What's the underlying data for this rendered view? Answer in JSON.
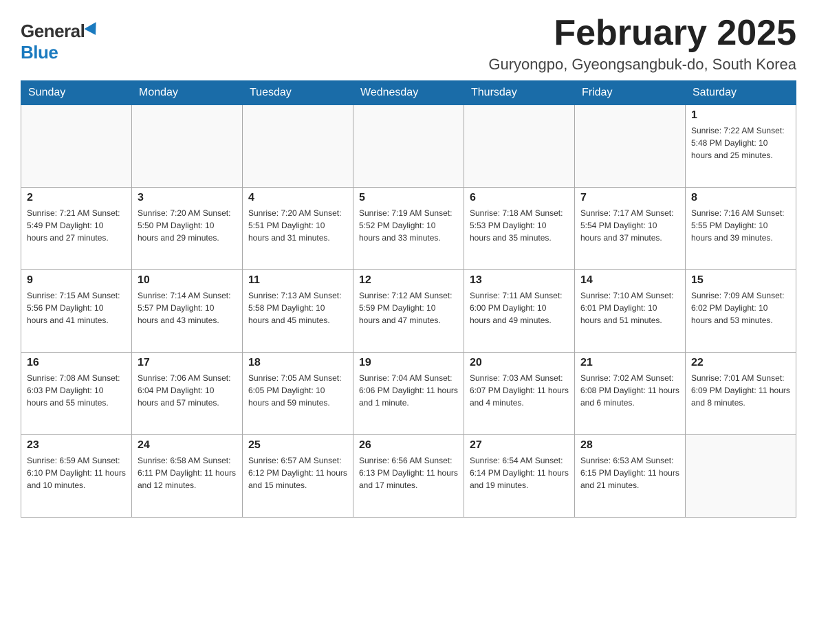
{
  "header": {
    "logo_general": "General",
    "logo_blue": "Blue",
    "month_title": "February 2025",
    "location": "Guryongpo, Gyeongsangbuk-do, South Korea"
  },
  "weekdays": [
    "Sunday",
    "Monday",
    "Tuesday",
    "Wednesday",
    "Thursday",
    "Friday",
    "Saturday"
  ],
  "weeks": [
    [
      {
        "day": "",
        "info": ""
      },
      {
        "day": "",
        "info": ""
      },
      {
        "day": "",
        "info": ""
      },
      {
        "day": "",
        "info": ""
      },
      {
        "day": "",
        "info": ""
      },
      {
        "day": "",
        "info": ""
      },
      {
        "day": "1",
        "info": "Sunrise: 7:22 AM\nSunset: 5:48 PM\nDaylight: 10 hours and 25 minutes."
      }
    ],
    [
      {
        "day": "2",
        "info": "Sunrise: 7:21 AM\nSunset: 5:49 PM\nDaylight: 10 hours and 27 minutes."
      },
      {
        "day": "3",
        "info": "Sunrise: 7:20 AM\nSunset: 5:50 PM\nDaylight: 10 hours and 29 minutes."
      },
      {
        "day": "4",
        "info": "Sunrise: 7:20 AM\nSunset: 5:51 PM\nDaylight: 10 hours and 31 minutes."
      },
      {
        "day": "5",
        "info": "Sunrise: 7:19 AM\nSunset: 5:52 PM\nDaylight: 10 hours and 33 minutes."
      },
      {
        "day": "6",
        "info": "Sunrise: 7:18 AM\nSunset: 5:53 PM\nDaylight: 10 hours and 35 minutes."
      },
      {
        "day": "7",
        "info": "Sunrise: 7:17 AM\nSunset: 5:54 PM\nDaylight: 10 hours and 37 minutes."
      },
      {
        "day": "8",
        "info": "Sunrise: 7:16 AM\nSunset: 5:55 PM\nDaylight: 10 hours and 39 minutes."
      }
    ],
    [
      {
        "day": "9",
        "info": "Sunrise: 7:15 AM\nSunset: 5:56 PM\nDaylight: 10 hours and 41 minutes."
      },
      {
        "day": "10",
        "info": "Sunrise: 7:14 AM\nSunset: 5:57 PM\nDaylight: 10 hours and 43 minutes."
      },
      {
        "day": "11",
        "info": "Sunrise: 7:13 AM\nSunset: 5:58 PM\nDaylight: 10 hours and 45 minutes."
      },
      {
        "day": "12",
        "info": "Sunrise: 7:12 AM\nSunset: 5:59 PM\nDaylight: 10 hours and 47 minutes."
      },
      {
        "day": "13",
        "info": "Sunrise: 7:11 AM\nSunset: 6:00 PM\nDaylight: 10 hours and 49 minutes."
      },
      {
        "day": "14",
        "info": "Sunrise: 7:10 AM\nSunset: 6:01 PM\nDaylight: 10 hours and 51 minutes."
      },
      {
        "day": "15",
        "info": "Sunrise: 7:09 AM\nSunset: 6:02 PM\nDaylight: 10 hours and 53 minutes."
      }
    ],
    [
      {
        "day": "16",
        "info": "Sunrise: 7:08 AM\nSunset: 6:03 PM\nDaylight: 10 hours and 55 minutes."
      },
      {
        "day": "17",
        "info": "Sunrise: 7:06 AM\nSunset: 6:04 PM\nDaylight: 10 hours and 57 minutes."
      },
      {
        "day": "18",
        "info": "Sunrise: 7:05 AM\nSunset: 6:05 PM\nDaylight: 10 hours and 59 minutes."
      },
      {
        "day": "19",
        "info": "Sunrise: 7:04 AM\nSunset: 6:06 PM\nDaylight: 11 hours and 1 minute."
      },
      {
        "day": "20",
        "info": "Sunrise: 7:03 AM\nSunset: 6:07 PM\nDaylight: 11 hours and 4 minutes."
      },
      {
        "day": "21",
        "info": "Sunrise: 7:02 AM\nSunset: 6:08 PM\nDaylight: 11 hours and 6 minutes."
      },
      {
        "day": "22",
        "info": "Sunrise: 7:01 AM\nSunset: 6:09 PM\nDaylight: 11 hours and 8 minutes."
      }
    ],
    [
      {
        "day": "23",
        "info": "Sunrise: 6:59 AM\nSunset: 6:10 PM\nDaylight: 11 hours and 10 minutes."
      },
      {
        "day": "24",
        "info": "Sunrise: 6:58 AM\nSunset: 6:11 PM\nDaylight: 11 hours and 12 minutes."
      },
      {
        "day": "25",
        "info": "Sunrise: 6:57 AM\nSunset: 6:12 PM\nDaylight: 11 hours and 15 minutes."
      },
      {
        "day": "26",
        "info": "Sunrise: 6:56 AM\nSunset: 6:13 PM\nDaylight: 11 hours and 17 minutes."
      },
      {
        "day": "27",
        "info": "Sunrise: 6:54 AM\nSunset: 6:14 PM\nDaylight: 11 hours and 19 minutes."
      },
      {
        "day": "28",
        "info": "Sunrise: 6:53 AM\nSunset: 6:15 PM\nDaylight: 11 hours and 21 minutes."
      },
      {
        "day": "",
        "info": ""
      }
    ]
  ]
}
